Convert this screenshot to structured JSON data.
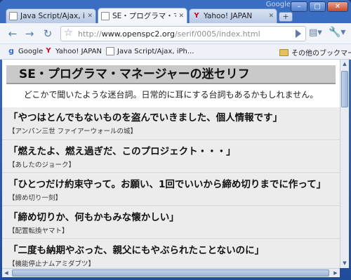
{
  "window": {
    "brand": "Google",
    "minimize": "–",
    "maximize": "□",
    "close": "✕"
  },
  "tabs": [
    {
      "label": "Java Script/Ajax, i...",
      "icon": "page-icon",
      "active": false
    },
    {
      "label": "SE・プログラマ・マネー...",
      "icon": "page-icon",
      "active": true
    },
    {
      "label": "Yahoo! JAPAN",
      "icon": "yahoo-icon",
      "active": false
    }
  ],
  "toolbar": {
    "url_prefix": "http://",
    "url_host": "www.openspc2.org",
    "url_path": "/serif/0005/index.html"
  },
  "bookmarks": {
    "items": [
      {
        "label": "Google",
        "icon": "google-icon"
      },
      {
        "label": "Yahoo! JAPAN",
        "icon": "yahoo-icon"
      },
      {
        "label": "Java Script/Ajax, iPh...",
        "icon": "page-icon"
      }
    ],
    "other": "その他のブックマーク"
  },
  "page": {
    "title": "SE・プログラマ・マネージャーの迷セリフ",
    "lead": "どこかで聞いたような迷台詞。日常的に耳にする台詞もあるかもしれません。",
    "entries": [
      {
        "quote": "「やつはとんでもないものを盗んでいきました、個人情報です」",
        "source": "【アンパン三世 ファイアーウォールの城】"
      },
      {
        "quote": "「燃えたよ、燃え過ぎだ、このプロジェクト・・・」",
        "source": "【あしたのジョーク】"
      },
      {
        "quote": "「ひとつだけ約束守って。お願い、1回でいいから締め切りまでに作って」",
        "source": "【締め切り一刻】"
      },
      {
        "quote": "「締め切りか、何もかもみな懐かしい」",
        "source": "【配置転換ヤマト】"
      },
      {
        "quote": "「二度も納期やぶった、親父にもやぶられたことないのに」",
        "source": "【機能停止ナムアミダブツ】"
      }
    ]
  }
}
